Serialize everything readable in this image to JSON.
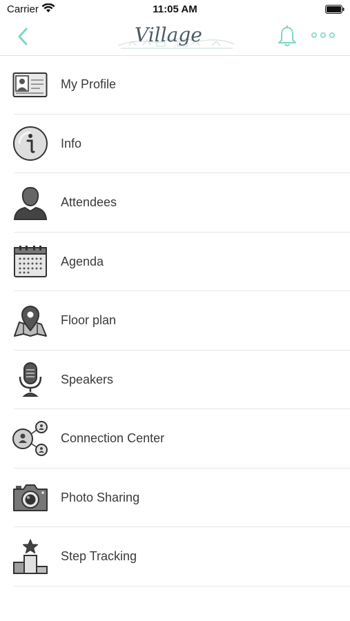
{
  "status_bar": {
    "carrier": "Carrier",
    "time": "11:05 AM"
  },
  "nav_bar": {
    "logo_text": "Village",
    "accent_color": "#7dd6c4"
  },
  "menu": {
    "items": [
      {
        "label": "My Profile",
        "icon": "id-card-icon"
      },
      {
        "label": "Info",
        "icon": "info-icon"
      },
      {
        "label": "Attendees",
        "icon": "person-icon"
      },
      {
        "label": "Agenda",
        "icon": "calendar-icon"
      },
      {
        "label": "Floor plan",
        "icon": "map-pin-icon"
      },
      {
        "label": "Speakers",
        "icon": "microphone-icon"
      },
      {
        "label": "Connection Center",
        "icon": "network-icon"
      },
      {
        "label": "Photo Sharing",
        "icon": "camera-icon"
      },
      {
        "label": "Step Tracking",
        "icon": "podium-icon"
      }
    ]
  }
}
